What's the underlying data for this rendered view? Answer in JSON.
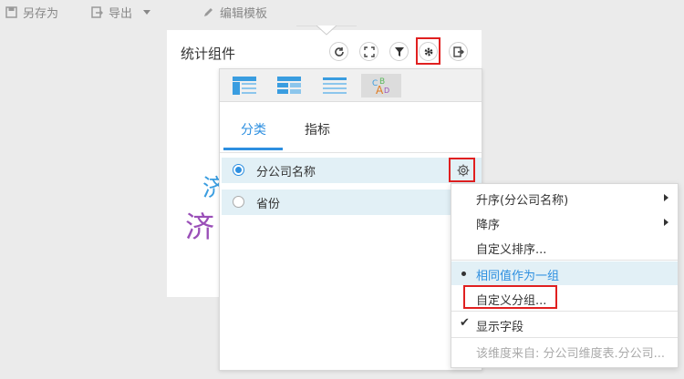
{
  "toolbar": {
    "save_as": "另存为",
    "export": "导出",
    "edit_template": "编辑模板"
  },
  "widget": {
    "title": "统计组件",
    "preview_chars": [
      "济",
      "济"
    ],
    "preview_colors": [
      "#3a9de0",
      "#9a4fb8"
    ]
  },
  "panel": {
    "tabs": [
      "分类",
      "指标"
    ],
    "active_tab": "分类",
    "dimensions": [
      {
        "label": "分公司名称",
        "selected": true
      },
      {
        "label": "省份",
        "selected": false
      }
    ]
  },
  "menu": {
    "items": [
      {
        "label": "升序(分公司名称)",
        "submenu": true
      },
      {
        "label": "降序",
        "submenu": true
      },
      {
        "label": "自定义排序..."
      },
      {
        "label": "相同值作为一组",
        "selected": true
      },
      {
        "label": "自定义分组..."
      },
      {
        "label": "显示字段",
        "checked": true
      },
      {
        "label": "该维度来自: 分公司维度表.分公司...",
        "disabled": true
      }
    ]
  },
  "colors": {
    "accent": "#2d8fe0",
    "highlight_box": "#e02020",
    "row_bg": "#e2f0f6"
  }
}
